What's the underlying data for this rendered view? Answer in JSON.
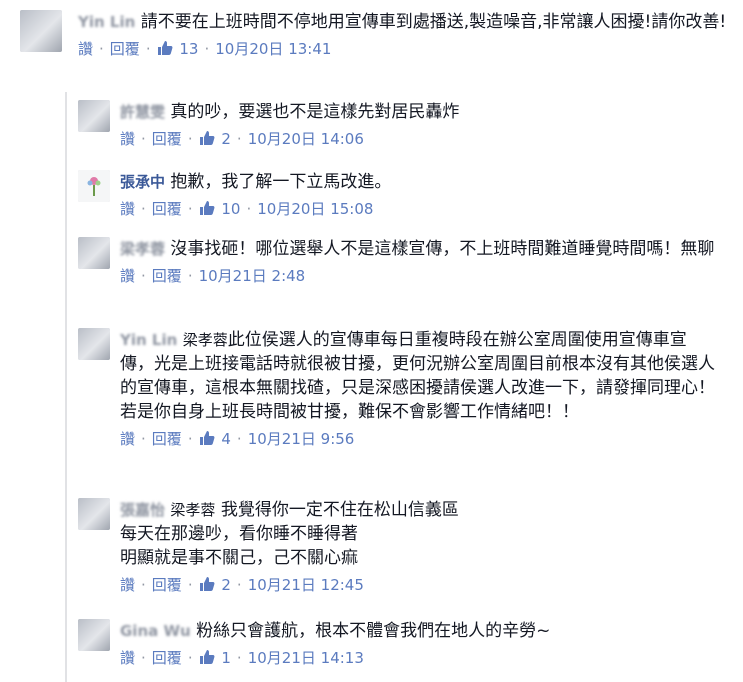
{
  "actions": {
    "like": "讚",
    "reply": "回覆",
    "sep": "·"
  },
  "comments": [
    {
      "name": "Yin Lin",
      "text": "請不要在上班時間不停地用宣傳車到處播送,製造噪音,非常讓人困擾!請你改善!",
      "likes": "13",
      "date": "10月20日 13:41"
    },
    {
      "name": "許慧雯",
      "text": "真的吵，要選也不是這樣先對居民轟炸",
      "likes": "2",
      "date": "10月20日 14:06"
    },
    {
      "name": "張承中",
      "text": "抱歉，我了解一下立馬改進。",
      "likes": "10",
      "date": "10月20日 15:08"
    },
    {
      "name": "梁孝蓉",
      "text": "沒事找砸！哪位選舉人不是這樣宣傳，不上班時間難道睡覺時間嗎！無聊",
      "likes": "",
      "date": "10月21日 2:48"
    },
    {
      "name": "Yin Lin",
      "mention": "梁孝蓉",
      "text": "此位侯選人的宣傳車每日重複時段在辦公室周圍使用宣傳車宣傳，光是上班接電話時就很被甘擾，更何況辦公室周圍目前根本沒有其他侯選人的宣傳車，這根本無關找碴，只是深感困擾請侯選人改進一下，請發揮同理心！若是你自身上班長時間被甘擾，難保不會影響工作情緒吧！！",
      "likes": "4",
      "date": "10月21日 9:56"
    },
    {
      "name": "張嘉怡",
      "mention": "梁孝蓉",
      "text": "我覺得你一定不住在松山信義區",
      "line2": "每天在那邊吵，看你睡不睡得著",
      "line3": "明顯就是事不關己，己不關心痲",
      "likes": "2",
      "date": "10月21日 12:45"
    },
    {
      "name": "Gina Wu",
      "text": "粉絲只會護航，根本不體會我們在地人的辛勞~",
      "likes": "1",
      "date": "10月21日 14:13"
    }
  ],
  "colors": {
    "link": "#3b5998",
    "meta": "#9197a3",
    "like": "#5b7bbf"
  },
  "icons": {
    "like": "thumbs-up-icon"
  }
}
